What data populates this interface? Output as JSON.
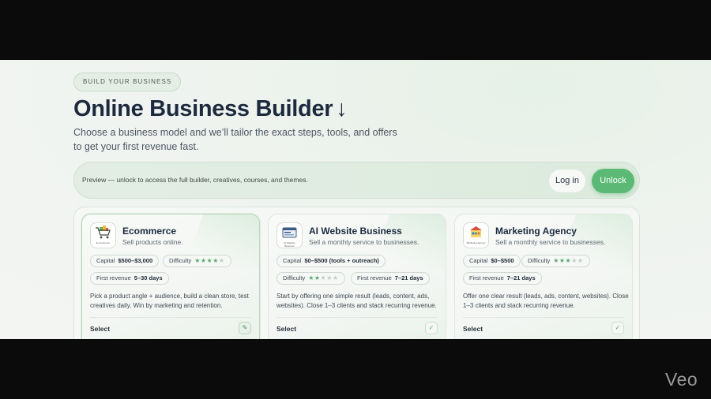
{
  "eyebrow": "BUILD YOUR BUSINESS",
  "title": "Online Business Builder",
  "title_icon": "down-arrow-icon",
  "subtitle": "Choose a business model and we’ll tailor the exact steps, tools, and offers to get your first revenue fast.",
  "preview": {
    "text": "Preview — unlock to access the full builder, creatives, courses, and themes.",
    "login_label": "Log in",
    "unlock_label": "Unlock"
  },
  "colors": {
    "accent": "#5cb975",
    "title": "#1d2a3e"
  },
  "cards": [
    {
      "title": "Ecommerce",
      "subtitle": "Sell products online.",
      "logo_caption": "E-commerce",
      "icon": "shopping-cart-icon",
      "capital_label": "Capital",
      "capital_value": "$500–$3,000",
      "difficulty_label": "Difficulty",
      "difficulty_stars": 4,
      "first_revenue_label": "First revenue",
      "first_revenue_value": "5–30 days",
      "description": "Pick a product angle + audience, build a clean store, test creatives daily. Win by marketing and retention.",
      "select_label": "Select",
      "action_icon": "pencil-icon",
      "selected": true
    },
    {
      "title": "AI Website Business",
      "subtitle": "Sell a monthly service to businesses.",
      "logo_caption": "AI Website Business",
      "icon": "website-browser-icon",
      "capital_label": "Capital",
      "capital_value": "$0–$500 (tools + outreach)",
      "difficulty_label": "Difficulty",
      "difficulty_stars": 2,
      "first_revenue_label": "First revenue",
      "first_revenue_value": "7–21 days",
      "description": "Start by offering one simple result (leads, content, ads, websites). Close 1–3 clients and stack recurring revenue.",
      "select_label": "Select",
      "action_icon": "check-icon",
      "selected": false
    },
    {
      "title": "Marketing Agency",
      "subtitle": "Sell a monthly service to businesses.",
      "logo_caption": "Marketing Agency",
      "icon": "agency-team-icon",
      "capital_label": "Capital",
      "capital_value": "$0–$500",
      "difficulty_label": "Difficulty",
      "difficulty_stars": 3,
      "first_revenue_label": "First revenue",
      "first_revenue_value": "7–21 days",
      "description": "Offer one clear result (leads, ads, content, websites). Close 1–3 clients and stack recurring revenue.",
      "select_label": "Select",
      "action_icon": "check-icon",
      "selected": false
    }
  ],
  "watermark": "Veo"
}
